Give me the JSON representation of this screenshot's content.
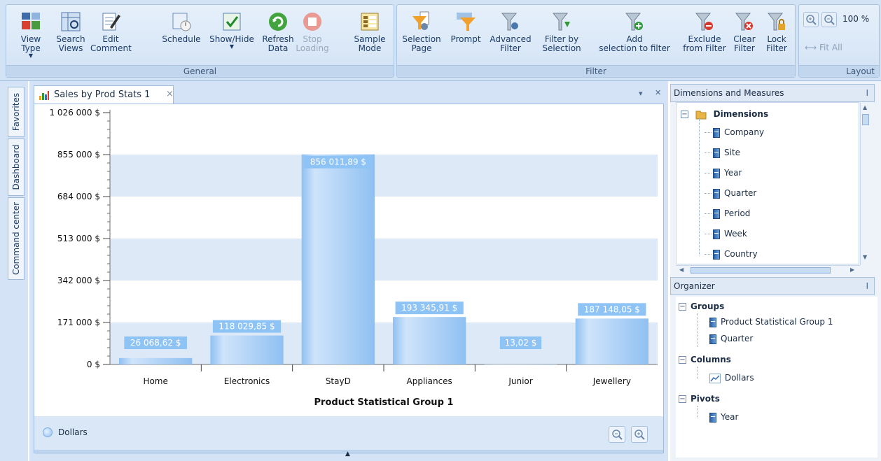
{
  "ribbon": {
    "general_buttons": [
      "View Type",
      "Search\nViews",
      "Edit\nComment",
      "Schedule",
      "Show/Hide",
      "Refresh\nData",
      "Stop\nLoading",
      "Sample\nMode"
    ],
    "filter_buttons": [
      "Selection\nPage",
      "Prompt",
      "Advanced\nFilter",
      "Filter by\nSelection",
      "Add\nselection to filter",
      "Exclude\nfrom Filter",
      "Clear\nFilter",
      "Lock\nFilter"
    ],
    "group_titles": {
      "general": "General",
      "filter": "Filter",
      "layout": "Layout"
    },
    "zoom_value": "100 %",
    "fit_all": "Fit All"
  },
  "side_tabs": [
    "Favorites",
    "Dashboard",
    "Command center"
  ],
  "document": {
    "tab_title": "Sales by Prod Stats 1",
    "tab_close": "×",
    "pin": "▾",
    "close": "✕"
  },
  "chart_data": {
    "type": "bar",
    "categories": [
      "Home",
      "Electronics",
      "StayD",
      "Appliances",
      "Junior",
      "Jewellery"
    ],
    "values": [
      26068.62,
      118029.85,
      856011.89,
      193345.91,
      13.02,
      187148.05
    ],
    "value_labels": [
      "26 068,62 $",
      "118 029,85 $",
      "856 011,89 $",
      "193 345,91 $",
      "13,02 $",
      "187 148,05 $"
    ],
    "y_ticks": [
      "0 $",
      "171 000 $",
      "342 000 $",
      "513 000 $",
      "684 000 $",
      "855 000 $",
      "1 026 000 $"
    ],
    "y_tick_values": [
      0,
      171000,
      342000,
      513000,
      684000,
      855000,
      1026000
    ],
    "ylim": [
      0,
      1026000
    ],
    "xlabel": "Product Statistical Group 1",
    "series": [
      {
        "name": "Dollars"
      }
    ],
    "colors": {
      "bar_light": "#cfe4fb",
      "bar_dark": "#8fc0f2",
      "label_bg": "#8ec3f5",
      "band": "#dde9f7"
    }
  },
  "legend": {
    "label": "Dollars"
  },
  "dimensions_panel": {
    "title": "Dimensions and Measures",
    "root": "Dimensions",
    "items": [
      "Company",
      "Site",
      "Year",
      "Quarter",
      "Period",
      "Week",
      "Country"
    ]
  },
  "organizer": {
    "title": "Organizer",
    "groups_label": "Groups",
    "groups": [
      "Product Statistical Group 1",
      "Quarter"
    ],
    "columns_label": "Columns",
    "columns": [
      "Dollars"
    ],
    "pivots_label": "Pivots",
    "pivots": [
      "Year"
    ]
  }
}
